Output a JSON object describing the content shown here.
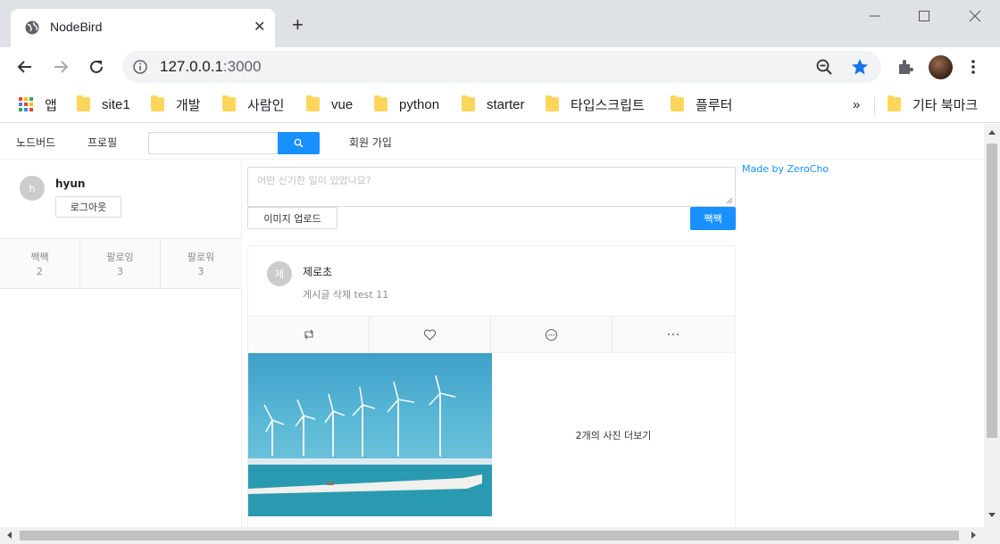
{
  "browser": {
    "tab_title": "NodeBird",
    "url_host": "127.0.0.1",
    "url_port": ":3000",
    "bookmarks": [
      {
        "label": "앱",
        "icon": "apps-grid-icon"
      },
      {
        "label": "site1",
        "icon": "folder-icon"
      },
      {
        "label": "개발",
        "icon": "folder-icon"
      },
      {
        "label": "사람인",
        "icon": "folder-icon"
      },
      {
        "label": "vue",
        "icon": "folder-icon"
      },
      {
        "label": "python",
        "icon": "folder-icon"
      },
      {
        "label": "starter",
        "icon": "folder-icon"
      },
      {
        "label": "타입스크립트",
        "icon": "folder-icon"
      },
      {
        "label": "플루터",
        "icon": "folder-icon"
      }
    ],
    "bookmarks_overflow": "»",
    "other_bookmarks": "기타 북마크"
  },
  "menu": {
    "home": "노드버드",
    "profile": "프로필",
    "search_placeholder": "",
    "signup": "회원 가입"
  },
  "user": {
    "avatar_letter": "h",
    "nickname": "hyun",
    "logout_label": "로그아웃",
    "stats": [
      {
        "label": "짹짹",
        "value": "2"
      },
      {
        "label": "팔로잉",
        "value": "3"
      },
      {
        "label": "팔로워",
        "value": "3"
      }
    ]
  },
  "post_form": {
    "placeholder": "어떤 신기한 일이 있었나요?",
    "upload_label": "이미지 업로드",
    "submit_label": "짹짹"
  },
  "post": {
    "avatar_letter": "제",
    "author": "제로초",
    "content": "게시글 삭제 test 11",
    "actions": [
      "retweet-icon",
      "heart-icon",
      "message-icon",
      "ellipsis-icon"
    ],
    "more_photos": "2개의 사진 더보기"
  },
  "footer_link": "Made by ZeroCho",
  "colors": {
    "primary": "#1890ff",
    "chrome_star": "#1a73e8"
  }
}
